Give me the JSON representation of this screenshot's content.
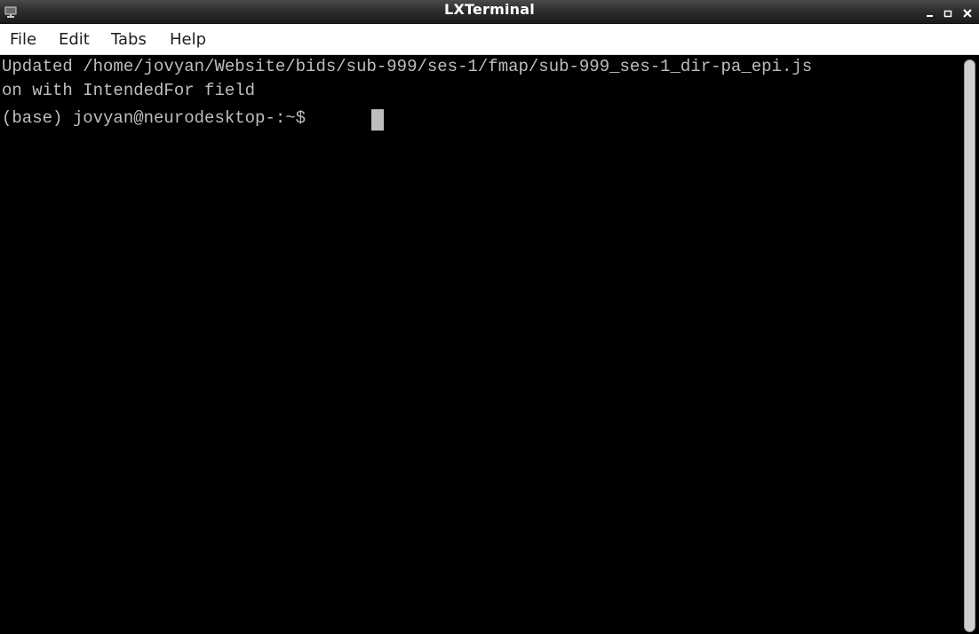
{
  "window": {
    "title": "LXTerminal",
    "app_icon": "monitor-icon",
    "controls": {
      "minimize_icon": "minimize-icon",
      "maximize_icon": "maximize-icon",
      "close_icon": "close-icon"
    }
  },
  "menubar": {
    "items": [
      {
        "label": "File"
      },
      {
        "label": "Edit"
      },
      {
        "label": "Tabs"
      },
      {
        "label": "Help"
      }
    ]
  },
  "terminal": {
    "lines": [
      "Updated /home/jovyan/Website/bids/sub-999/ses-1/fmap/sub-999_ses-1_dir-pa_epi.js",
      "on with IntendedFor field",
      "(base) jovyan@neurodesktop-:~$ "
    ],
    "cursor": "block-cursor"
  },
  "colors": {
    "terminal_bg": "#000000",
    "terminal_fg": "#bebebe",
    "titlebar_bg": "#2e2e2e",
    "menubar_bg": "#ffffff"
  }
}
